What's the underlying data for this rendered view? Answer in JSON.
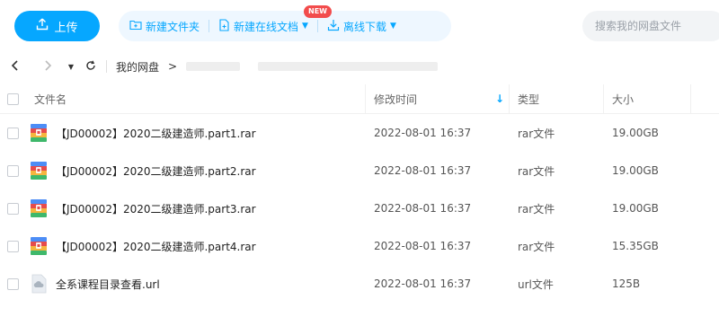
{
  "toolbar": {
    "upload_label": "上传",
    "new_folder_label": "新建文件夹",
    "new_online_doc_label": "新建在线文档",
    "new_badge": "NEW",
    "offline_download_label": "离线下载",
    "search_placeholder": "搜索我的网盘文件",
    "accent_color": "#06a7ff"
  },
  "breadcrumb": {
    "root": "我的网盘",
    "separator": ">"
  },
  "table": {
    "columns": {
      "name": "文件名",
      "modified": "修改时间",
      "type": "类型",
      "size": "大小"
    },
    "sort_indicator": "↓",
    "rows": [
      {
        "icon": "rar-archive-icon",
        "name": "【JD00002】2020二级建造师.part1.rar",
        "modified": "2022-08-01 16:37",
        "type": "rar文件",
        "size": "19.00GB"
      },
      {
        "icon": "rar-archive-icon",
        "name": "【JD00002】2020二级建造师.part2.rar",
        "modified": "2022-08-01 16:37",
        "type": "rar文件",
        "size": "19.00GB"
      },
      {
        "icon": "rar-archive-icon",
        "name": "【JD00002】2020二级建造师.part3.rar",
        "modified": "2022-08-01 16:37",
        "type": "rar文件",
        "size": "19.00GB"
      },
      {
        "icon": "rar-archive-icon",
        "name": "【JD00002】2020二级建造师.part4.rar",
        "modified": "2022-08-01 16:37",
        "type": "rar文件",
        "size": "15.35GB"
      },
      {
        "icon": "url-file-icon",
        "name": "全系课程目录查看.url",
        "modified": "2022-08-01 16:37",
        "type": "url文件",
        "size": "125B"
      }
    ]
  }
}
